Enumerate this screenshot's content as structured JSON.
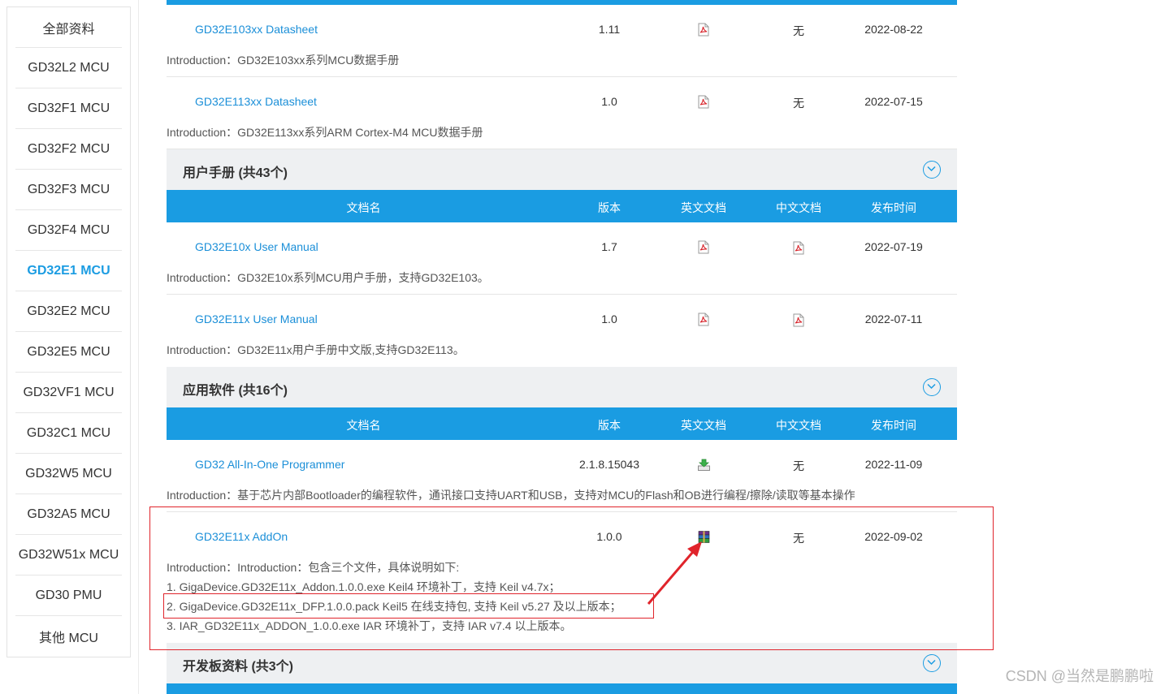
{
  "sidebar": {
    "items": [
      {
        "label": "全部资料",
        "active": false
      },
      {
        "label": "GD32L2  MCU",
        "active": false
      },
      {
        "label": "GD32F1  MCU",
        "active": false
      },
      {
        "label": "GD32F2  MCU",
        "active": false
      },
      {
        "label": "GD32F3  MCU",
        "active": false
      },
      {
        "label": "GD32F4  MCU",
        "active": false
      },
      {
        "label": "GD32E1  MCU",
        "active": true
      },
      {
        "label": "GD32E2  MCU",
        "active": false
      },
      {
        "label": "GD32E5  MCU",
        "active": false
      },
      {
        "label": "GD32VF1  MCU",
        "active": false
      },
      {
        "label": "GD32C1  MCU",
        "active": false
      },
      {
        "label": "GD32W5  MCU",
        "active": false
      },
      {
        "label": "GD32A5  MCU",
        "active": false
      },
      {
        "label": "GD32W51x  MCU",
        "active": false
      },
      {
        "label": "GD30 PMU",
        "active": false
      },
      {
        "label": "其他  MCU",
        "active": false
      }
    ]
  },
  "table_headers": {
    "name": "文档名",
    "version": "版本",
    "en": "英文文档",
    "cn": "中文文档",
    "date": "发布时间"
  },
  "datasheet_rows": [
    {
      "name": "GD32E103xx Datasheet",
      "version": "1.11",
      "cn": "无",
      "date": "2022-08-22",
      "intro": "Introduction：GD32E103xx系列MCU数据手册"
    },
    {
      "name": "GD32E113xx Datasheet",
      "version": "1.0",
      "cn": "无",
      "date": "2022-07-15",
      "intro": "Introduction：GD32E113xx系列ARM Cortex-M4 MCU数据手册"
    }
  ],
  "sections": {
    "manual": {
      "title": "用户手册 (共43个)"
    },
    "software": {
      "title": "应用软件 (共16个)"
    },
    "board": {
      "title": "开发板资料 (共3个)"
    }
  },
  "manual_rows": [
    {
      "name": "GD32E10x User Manual",
      "version": "1.7",
      "date": "2022-07-19",
      "intro": "Introduction：GD32E10x系列MCU用户手册，支持GD32E103。"
    },
    {
      "name": "GD32E11x User Manual",
      "version": "1.0",
      "date": "2022-07-11",
      "intro": "Introduction：GD32E11x用户手册中文版,支持GD32E113。"
    }
  ],
  "software_rows": [
    {
      "name": "GD32 All-In-One Programmer",
      "version": "2.1.8.15043",
      "cn": "无",
      "date": "2022-11-09",
      "intro": "Introduction：基于芯片内部Bootloader的编程软件，通讯接口支持UART和USB，支持对MCU的Flash和OB进行编程/擦除/读取等基本操作"
    },
    {
      "name": "GD32E11x AddOn",
      "version": "1.0.0",
      "cn": "无",
      "date": "2022-09-02",
      "intro_lines": [
        "Introduction：Introduction：包含三个文件，具体说明如下:",
        "1. GigaDevice.GD32E11x_Addon.1.0.0.exe Keil4 环境补丁，支持 Keil v4.7x；",
        "2. GigaDevice.GD32E11x_DFP.1.0.0.pack Keil5 在线支持包, 支持 Keil v5.27 及以上版本；",
        "3. IAR_GD32E11x_ADDON_1.0.0.exe IAR 环境补丁，支持 IAR v7.4 以上版本。"
      ]
    }
  ],
  "icons": {
    "pdf": "pdf-file-icon",
    "download": "download-icon",
    "archive": "archive-icon",
    "collapse": "chevron-down-icon"
  },
  "colors": {
    "accent": "#1a9ce2",
    "link": "#1b8fd8",
    "highlight": "#e0242b"
  },
  "watermark": "CSDN @当然是鹏鹏啦"
}
